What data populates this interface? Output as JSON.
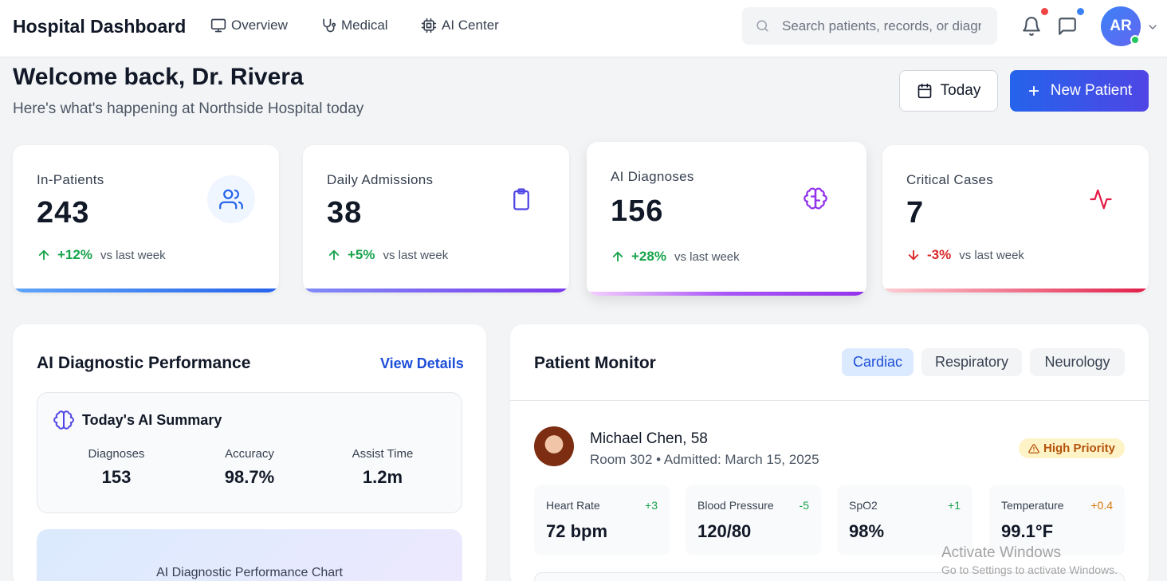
{
  "header": {
    "brand": "Hospital Dashboard",
    "nav": [
      {
        "label": "Overview",
        "icon": "monitor-icon"
      },
      {
        "label": "Medical",
        "icon": "stethoscope-icon"
      },
      {
        "label": "AI Center",
        "icon": "cpu-icon"
      }
    ],
    "search_placeholder": "Search patients, records, or diagnoses...",
    "user_initials": "AR"
  },
  "welcome": {
    "title": "Welcome back, Dr. Rivera",
    "subtitle": "Here's what's happening at Northside Hospital today",
    "today_label": "Today",
    "new_patient_label": "New Patient"
  },
  "stats": [
    {
      "label": "In-Patients",
      "value": "243",
      "change": "+12%",
      "direction": "up",
      "vs": "vs last week",
      "icon": "users-icon",
      "color": "#2563eb"
    },
    {
      "label": "Daily Admissions",
      "value": "38",
      "change": "+5%",
      "direction": "up",
      "vs": "vs last week",
      "icon": "clipboard-icon",
      "color": "#4f46e5"
    },
    {
      "label": "AI Diagnoses",
      "value": "156",
      "change": "+28%",
      "direction": "up",
      "vs": "vs last week",
      "icon": "brain-icon",
      "color": "#9333ea"
    },
    {
      "label": "Critical Cases",
      "value": "7",
      "change": "-3%",
      "direction": "down",
      "vs": "vs last week",
      "icon": "activity-icon",
      "color": "#e11d48"
    }
  ],
  "ai_panel": {
    "title": "AI Diagnostic Performance",
    "link": "View Details",
    "summary_title": "Today's AI Summary",
    "metrics": [
      {
        "label": "Diagnoses",
        "value": "153"
      },
      {
        "label": "Accuracy",
        "value": "98.7%"
      },
      {
        "label": "Assist Time",
        "value": "1.2m"
      }
    ],
    "chart_placeholder": "AI Diagnostic Performance Chart"
  },
  "monitor": {
    "title": "Patient Monitor",
    "tabs": [
      "Cardiac",
      "Respiratory",
      "Neurology"
    ],
    "active_tab": "Cardiac",
    "patient": {
      "name": "Michael Chen, 58",
      "room": "Room 302 • Admitted: March 15, 2025",
      "priority": "High Priority"
    },
    "vitals": [
      {
        "label": "Heart Rate",
        "value": "72 bpm",
        "delta": "+3",
        "delta_color": "#16a34a"
      },
      {
        "label": "Blood Pressure",
        "value": "120/80",
        "delta": "-5",
        "delta_color": "#16a34a"
      },
      {
        "label": "SpO2",
        "value": "98%",
        "delta": "+1",
        "delta_color": "#16a34a"
      },
      {
        "label": "Temperature",
        "value": "99.1°F",
        "delta": "+0.4",
        "delta_color": "#d97706"
      }
    ]
  },
  "watermark": {
    "line1": "Activate Windows",
    "line2": "Go to Settings to activate Windows."
  }
}
